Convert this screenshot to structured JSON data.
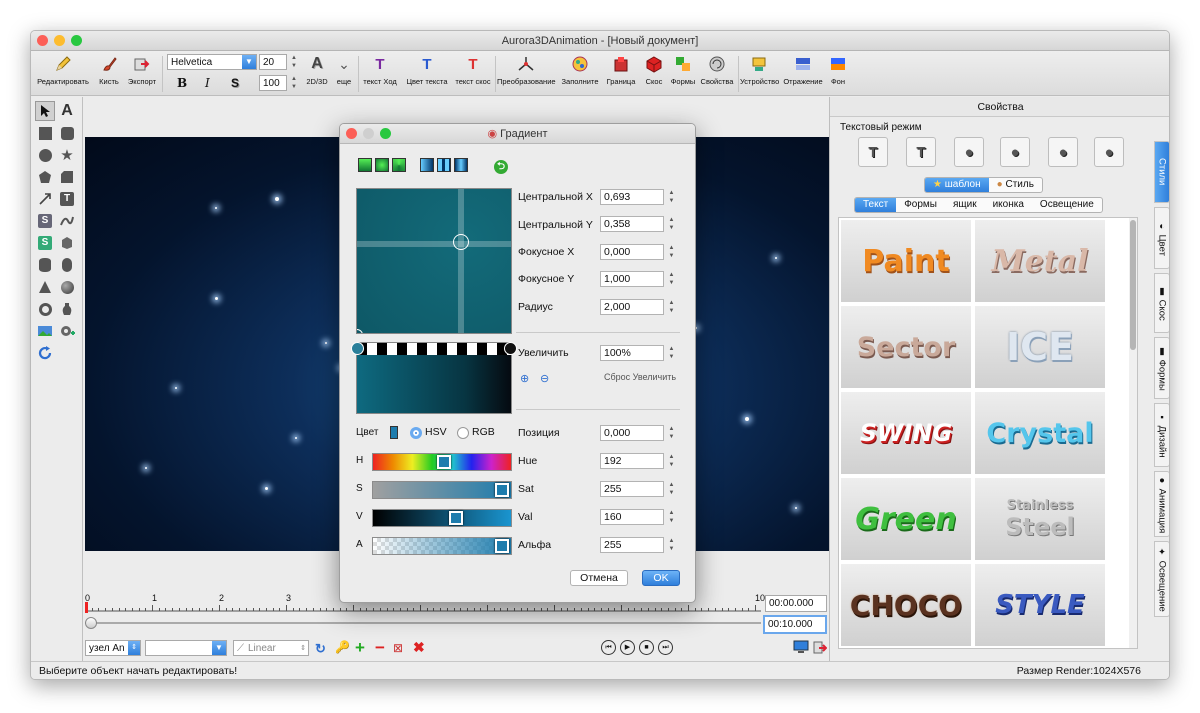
{
  "window": {
    "title": "Aurora3DAnimation - [Новый документ]"
  },
  "toolbar": {
    "edit": "Редактировать",
    "brush": "Кисть",
    "export": "Экспорт",
    "font": "Helvetica",
    "font_size": "20",
    "scale": "100",
    "bold": "B",
    "italic": "I",
    "shadow": "S",
    "mode2d3d": "2D/3D",
    "more": "еще",
    "text_path": "текст Ход",
    "text_color": "Цвет текста",
    "text_bevel": "текст скос",
    "transform": "Преобразование",
    "fill": "Заполните",
    "border": "Граница",
    "bevel": "Скос",
    "shapes": "Формы",
    "properties": "Свойства",
    "device": "Устройство",
    "reflection": "Отражение",
    "background": "Фон"
  },
  "timeline": {
    "ticks": [
      "0",
      "1",
      "2",
      "3",
      "10"
    ],
    "time_current": "00:00.000",
    "time_total": "00:10.000"
  },
  "bottombar": {
    "node": "узел An",
    "empty": "",
    "interp": "Linear"
  },
  "status": {
    "left": "Выберите объект начать редактировать!",
    "right": "Размер Render:1024X576"
  },
  "panel": {
    "title": "Свойства",
    "text_mode": "Текстовый режим",
    "seg1": [
      "шаблон",
      "Стиль"
    ],
    "seg2": [
      "Текст",
      "Формы",
      "ящик",
      "иконка",
      "Освещение"
    ],
    "gallery": [
      "Paint",
      "Metal",
      "Sector",
      "ICE",
      "SWING",
      "Crystal",
      "Green",
      "Stainless",
      "Steel",
      "CHOCO",
      "STYLE"
    ],
    "vtabs": [
      "Стили",
      "Цвет",
      "Скос",
      "Формы",
      "Дизайн",
      "Анимация",
      "Освещение"
    ]
  },
  "dialog": {
    "title": "Градиент",
    "labels": {
      "cx": "Центральной X",
      "cy": "Центральной Y",
      "fx": "Фокусное X",
      "fy": "Фокусное Y",
      "radius": "Радиус",
      "zoom": "Увеличить",
      "reset_zoom": "Сброс Увеличить",
      "color": "Цвет",
      "hsv": "HSV",
      "rgb": "RGB",
      "position": "Позиция",
      "H": "H",
      "S": "S",
      "V": "V",
      "A": "A",
      "hue": "Hue",
      "sat": "Sat",
      "val": "Val",
      "alpha": "Альфа"
    },
    "values": {
      "cx": "0,693",
      "cy": "0,358",
      "fx": "0,000",
      "fy": "1,000",
      "radius": "2,000",
      "zoom": "100%",
      "position": "0,000",
      "hue": "192",
      "sat": "255",
      "val": "160",
      "alpha": "255"
    },
    "buttons": {
      "cancel": "Отмена",
      "ok": "OK"
    }
  },
  "colors": {
    "accent": "#2f7fdb",
    "gradient_color": "#1d7cad"
  }
}
